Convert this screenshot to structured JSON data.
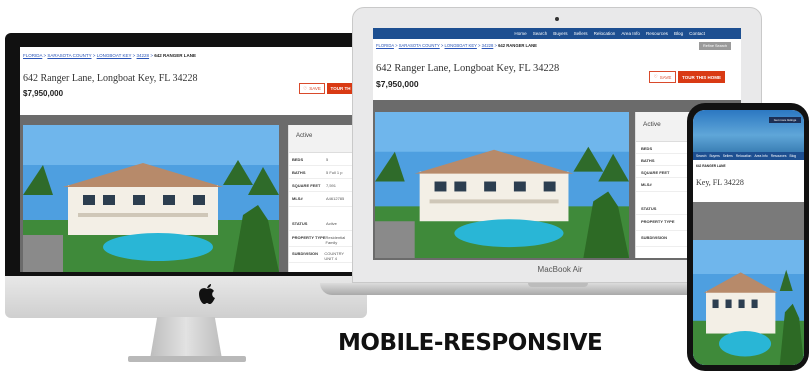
{
  "listing": {
    "breadcrumb": [
      "FLORIDA",
      "SARASOTA COUNTY",
      "LONGBOAT KEY",
      "34228"
    ],
    "breadcrumb_current": "642 RANGER LANE",
    "address": "642 Ranger Lane, Longboat Key, FL 34228",
    "address_phone": "Key, FL 34228",
    "price": "$7,950,000",
    "save_label": "SAVE",
    "tour_label": "TOUR THIS HOME",
    "tour_label_short": "TOUR TH",
    "status": "Active",
    "facts": [
      {
        "label": "BEDS",
        "value": "5"
      },
      {
        "label": "BATHS",
        "value": "5 Full 1 p"
      },
      {
        "label": "SQUARE FEET",
        "value": "7,591"
      },
      {
        "label": "MLS#",
        "value": "A4612785"
      }
    ],
    "details": [
      {
        "label": "STATUS",
        "value": "Active"
      },
      {
        "label": "PROPERTY TYPE",
        "value": "Residential Family"
      },
      {
        "label": "SUBDIVISION",
        "value": "COUNTRY UNIT 4"
      }
    ],
    "mb_facts_labels": [
      "BEDS",
      "BATHS",
      "SQUARE FEET",
      "MLS#"
    ],
    "mb_details_labels": [
      "STATUS",
      "PROPERTY TYPE",
      "SUBDIVISION"
    ]
  },
  "nav": {
    "items": [
      "Home",
      "Search",
      "Buyers",
      "Sellers",
      "Relocation",
      "Area Info",
      "Resources",
      "Blog",
      "Contact"
    ],
    "refine_label": "Refine Search",
    "phone_items": [
      "Search",
      "Buyers",
      "Sellers",
      "Relocation",
      "Area Info",
      "Resources",
      "Blog"
    ],
    "phone_cta": "Get more listings"
  },
  "devices": {
    "macbook_label": "MacBook Air"
  },
  "tagline": "MOBILE-RESPONSIVE",
  "colors": {
    "nav_blue": "#1d4f91",
    "tour_red": "#d93a14",
    "link_blue": "#2a55b8"
  },
  "icons": {
    "save": "heart-icon",
    "brand": "apple-logo-icon"
  }
}
